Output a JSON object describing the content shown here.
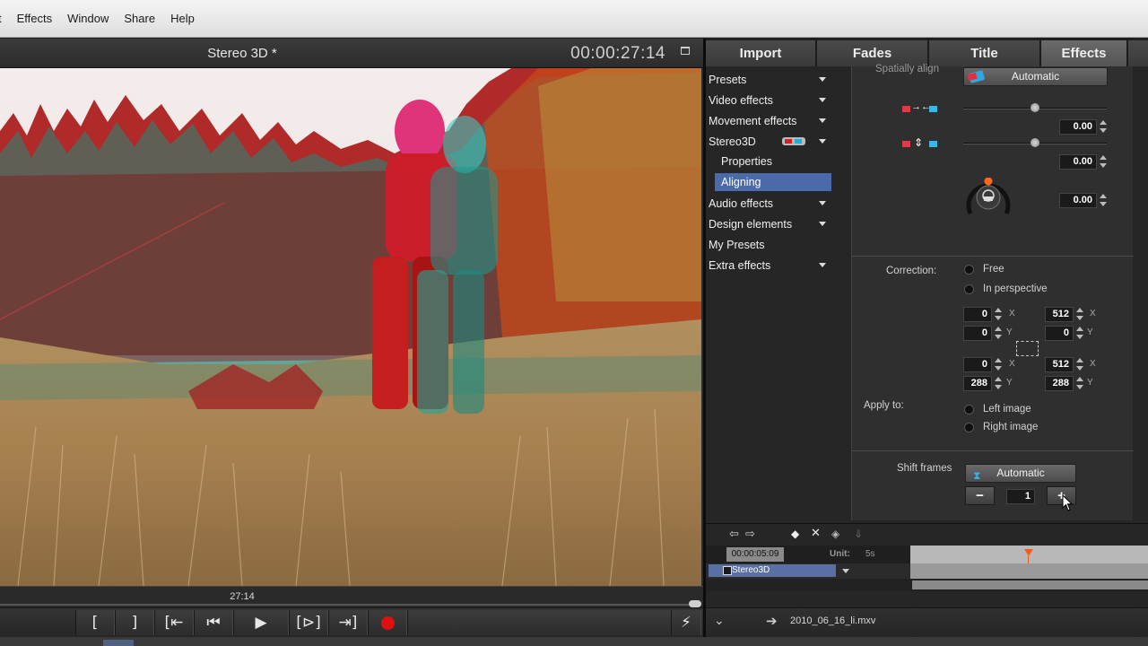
{
  "menu": [
    "t",
    "Effects",
    "Window",
    "Share",
    "Help"
  ],
  "preview": {
    "title": "Stereo 3D *",
    "timecode": "00:00:27:14",
    "scrub_label": "27:14"
  },
  "transport": {
    "icons": [
      "mark-in-icon",
      "mark-out-icon",
      "go-to-mark-in-icon",
      "prev-frame-icon",
      "play-icon",
      "next-marker-icon",
      "go-to-mark-out-icon",
      "record-icon"
    ],
    "glyphs": [
      "[",
      "]",
      "[⇤",
      "⏮",
      "▶",
      "[⊳]",
      "⇥]",
      "",
      "⚡"
    ]
  },
  "tabs": [
    {
      "label": "Import",
      "active": false
    },
    {
      "label": "Fades",
      "active": false
    },
    {
      "label": "Title",
      "active": false
    },
    {
      "label": "Effects",
      "active": true
    }
  ],
  "categories": [
    {
      "label": "Presets",
      "arrow": true
    },
    {
      "label": "Video effects",
      "arrow": true
    },
    {
      "label": "Movement effects",
      "arrow": true
    },
    {
      "label": "Stereo3D",
      "arrow": true
    },
    {
      "label": "Properties",
      "sub": true
    },
    {
      "label": "Aligning",
      "sub": true,
      "selected": true
    },
    {
      "label": "Audio effects",
      "arrow": true
    },
    {
      "label": "Design elements",
      "arrow": true
    },
    {
      "label": "My Presets",
      "arrow": false
    },
    {
      "label": "Extra effects",
      "arrow": true
    }
  ],
  "align": {
    "section_label": "Spatially align",
    "auto_button": "Automatic",
    "horizontal_value": "0.00",
    "vertical_value": "0.00",
    "rotation_value": "0.00"
  },
  "correction": {
    "label": "Correction:",
    "options": [
      "Free",
      "In perspective"
    ],
    "fields": {
      "tl_x": "0",
      "tl_y": "0",
      "tr_x": "512",
      "tr_y": "0",
      "bl_x": "0",
      "bl_y": "288",
      "br_x": "512",
      "br_y": "288"
    },
    "axis_x": "X",
    "axis_y": "Y"
  },
  "apply_to": {
    "label": "Apply to:",
    "options": [
      "Left image",
      "Right image"
    ]
  },
  "shift_frames": {
    "label": "Shift frames",
    "auto_button": "Automatic",
    "value": "1",
    "minus": "−",
    "plus": "+"
  },
  "timeline": {
    "time": "00:00:05:09",
    "unit_label": "Unit:",
    "unit_value": "5s",
    "track_name": "Stereo3D"
  },
  "bottom": {
    "file_name": "2010_06_16_li.mxv"
  },
  "colors": {
    "accent": "#4a6aaa",
    "record": "#e01010",
    "anaglyph_red": "#d42020",
    "anaglyph_cyan": "#1fb0d8",
    "playhead": "#ff5a1a"
  }
}
